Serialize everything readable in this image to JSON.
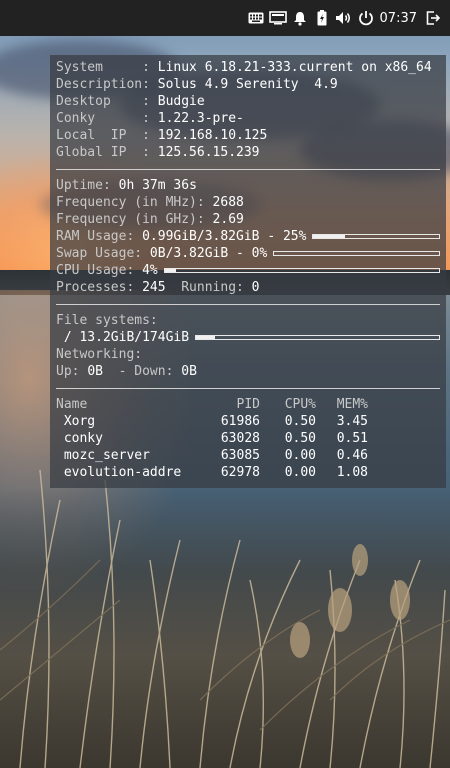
{
  "panel": {
    "clock": "07:37",
    "tray_icons": [
      "keyboard-icon",
      "display-icon",
      "bell-icon",
      "battery-icon",
      "volume-icon",
      "power-icon",
      "logout-icon"
    ]
  },
  "conky": {
    "system_label": "System     : ",
    "system_value": "Linux 6.18.21-333.current on x86_64",
    "description_label": "Description: ",
    "description_value": "Solus 4.9 Serenity  4.9",
    "desktop_label": "Desktop    : ",
    "desktop_value": "Budgie",
    "conky_label": "Conky      : ",
    "conky_value": "1.22.3-pre-",
    "local_ip_label": "Local  IP  : ",
    "local_ip_value": "192.168.10.125",
    "global_ip_label": "Global IP  : ",
    "global_ip_value": "125.56.15.239",
    "uptime_label": "Uptime: ",
    "uptime_value": "0h 37m 36s",
    "freq_mhz_label": "Frequency (in MHz): ",
    "freq_mhz_value": "2688",
    "freq_ghz_label": "Frequency (in GHz): ",
    "freq_ghz_value": "2.69",
    "ram_label": "RAM Usage: ",
    "ram_value": "0.99GiB/3.82GiB - 25%",
    "ram_fraction": 0.25,
    "swap_label": "Swap Usage: ",
    "swap_value": "0B/3.82GiB - 0%",
    "swap_fraction": 0.0,
    "cpu_label": "CPU Usage: ",
    "cpu_value": "4%",
    "cpu_fraction": 0.04,
    "processes_label": "Processes: ",
    "processes_value": "245",
    "running_label": "  Running: ",
    "running_value": "0",
    "fs_label": "File systems:",
    "fs_root": " / 13.2GiB/174GiB",
    "fs_fraction": 0.076,
    "net_label": "Networking:",
    "up_label": "Up: ",
    "up_value": "0B",
    "down_label": "  - Down: ",
    "down_value": "0B",
    "proc_headers": {
      "name": "Name",
      "pid": "PID",
      "cpu": "CPU%",
      "mem": "MEM%"
    },
    "processes": [
      {
        "name": " Xorg",
        "pid": "61986",
        "cpu": "0.50",
        "mem": "3.45"
      },
      {
        "name": " conky",
        "pid": "63028",
        "cpu": "0.50",
        "mem": "0.51"
      },
      {
        "name": " mozc_server",
        "pid": "63085",
        "cpu": "0.00",
        "mem": "0.46"
      },
      {
        "name": " evolution-addre",
        "pid": "62978",
        "cpu": "0.00",
        "mem": "1.08"
      }
    ]
  }
}
